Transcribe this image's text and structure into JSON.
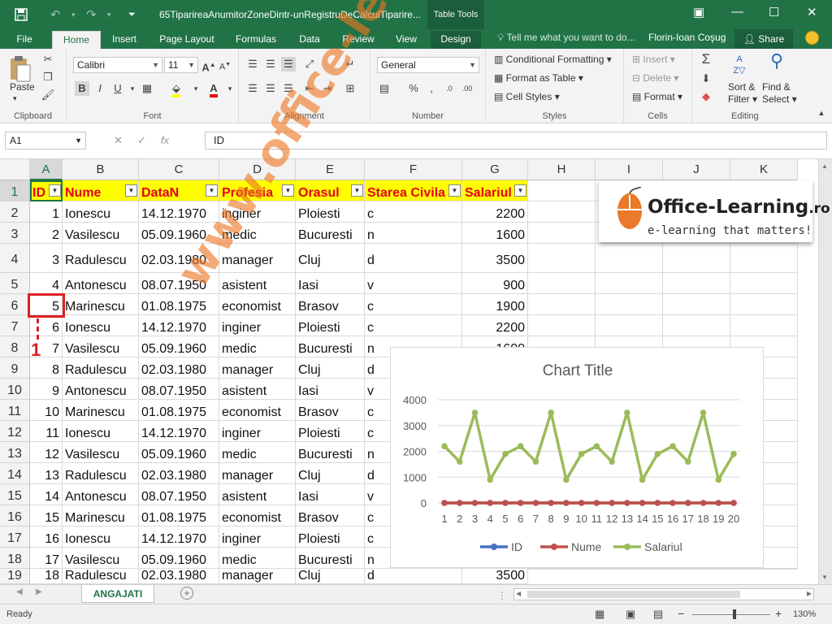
{
  "title": "65TiparireaAnumitorZoneDintr-unRegistruDeCalculTiparire...",
  "table_tools": "Table Tools",
  "tabs": [
    "File",
    "Home",
    "Insert",
    "Page Layout",
    "Formulas",
    "Data",
    "Review",
    "View",
    "Design"
  ],
  "tell_me": "Tell me what you want to do...",
  "user": "Florin-Ioan Coşug",
  "share": "Share",
  "ribbon": {
    "clipboard": {
      "label": "Clipboard",
      "paste": "Paste"
    },
    "font": {
      "label": "Font",
      "name": "Calibri",
      "size": "11"
    },
    "alignment": {
      "label": "Alignment"
    },
    "number": {
      "label": "Number",
      "format": "General"
    },
    "styles": {
      "label": "Styles",
      "conditional": "Conditional Formatting",
      "format_table": "Format as Table",
      "cell_styles": "Cell Styles"
    },
    "cells": {
      "label": "Cells",
      "insert": "Insert",
      "delete": "Delete",
      "format": "Format"
    },
    "editing": {
      "label": "Editing",
      "sort": "Sort &",
      "filter": "Filter",
      "find": "Find &",
      "select": "Select"
    }
  },
  "formula_bar": {
    "name_box": "A1",
    "value": "ID"
  },
  "columns": [
    "A",
    "B",
    "C",
    "D",
    "E",
    "F",
    "G",
    "H",
    "I",
    "J",
    "K"
  ],
  "headers": [
    "ID",
    "Nume",
    "DataN",
    "Profesia",
    "Orasul",
    "Starea Civila",
    "Salariul"
  ],
  "rows": [
    [
      "1",
      "Ionescu",
      "14.12.1970",
      "inginer",
      "Ploiesti",
      "c",
      "2200"
    ],
    [
      "2",
      "Vasilescu",
      "05.09.1960",
      "medic",
      "Bucuresti",
      "n",
      "1600"
    ],
    [
      "3",
      "Radulescu",
      "02.03.1980",
      "manager",
      "Cluj",
      "d",
      "3500"
    ],
    [
      "4",
      "Antonescu",
      "08.07.1950",
      "asistent",
      "Iasi",
      "v",
      "900"
    ],
    [
      "5",
      "Marinescu",
      "01.08.1975",
      "economist",
      "Brasov",
      "c",
      "1900"
    ],
    [
      "6",
      "Ionescu",
      "14.12.1970",
      "inginer",
      "Ploiesti",
      "c",
      "2200"
    ],
    [
      "7",
      "Vasilescu",
      "05.09.1960",
      "medic",
      "Bucuresti",
      "n",
      "1600"
    ],
    [
      "8",
      "Radulescu",
      "02.03.1980",
      "manager",
      "Cluj",
      "d",
      "3500"
    ],
    [
      "9",
      "Antonescu",
      "08.07.1950",
      "asistent",
      "Iasi",
      "v",
      "900"
    ],
    [
      "10",
      "Marinescu",
      "01.08.1975",
      "economist",
      "Brasov",
      "c",
      "1900"
    ],
    [
      "11",
      "Ionescu",
      "14.12.1970",
      "inginer",
      "Ploiesti",
      "c",
      "2200"
    ],
    [
      "12",
      "Vasilescu",
      "05.09.1960",
      "medic",
      "Bucuresti",
      "n",
      "1600"
    ],
    [
      "13",
      "Radulescu",
      "02.03.1980",
      "manager",
      "Cluj",
      "d",
      "3500"
    ],
    [
      "14",
      "Antonescu",
      "08.07.1950",
      "asistent",
      "Iasi",
      "v",
      "900"
    ],
    [
      "15",
      "Marinescu",
      "01.08.1975",
      "economist",
      "Brasov",
      "c",
      "1900"
    ],
    [
      "16",
      "Ionescu",
      "14.12.1970",
      "inginer",
      "Ploiesti",
      "c",
      "2200"
    ],
    [
      "17",
      "Vasilescu",
      "05.09.1960",
      "medic",
      "Bucuresti",
      "n",
      "1600"
    ],
    [
      "18",
      "Radulescu",
      "02.03.1980",
      "manager",
      "Cluj",
      "d",
      "3500"
    ]
  ],
  "annotation": "1",
  "sheet_tab": "ANGAJATI",
  "status": {
    "ready": "Ready",
    "zoom": "130%"
  },
  "logo": {
    "name": "Office-Learning",
    "suffix": ".ro",
    "tagline": "e-learning that matters!"
  },
  "watermark": "www.office-learning.ro",
  "chart_data": {
    "type": "line",
    "title": "Chart Title",
    "categories": [
      "1",
      "2",
      "3",
      "4",
      "5",
      "6",
      "7",
      "8",
      "9",
      "10",
      "11",
      "12",
      "13",
      "14",
      "15",
      "16",
      "17",
      "18",
      "19",
      "20"
    ],
    "ylim": [
      0,
      4000
    ],
    "yticks": [
      "0",
      "1000",
      "2000",
      "3000",
      "4000"
    ],
    "grid": true,
    "legend": "bottom",
    "series": [
      {
        "name": "ID",
        "color": "#4472c4",
        "values": [
          0,
          0,
          0,
          0,
          0,
          0,
          0,
          0,
          0,
          0,
          0,
          0,
          0,
          0,
          0,
          0,
          0,
          0,
          0,
          0
        ]
      },
      {
        "name": "Nume",
        "color": "#c0504d",
        "values": [
          0,
          0,
          0,
          0,
          0,
          0,
          0,
          0,
          0,
          0,
          0,
          0,
          0,
          0,
          0,
          0,
          0,
          0,
          0,
          0
        ]
      },
      {
        "name": "Salariul",
        "color": "#9bbb59",
        "values": [
          2200,
          1600,
          3500,
          900,
          1900,
          2200,
          1600,
          3500,
          900,
          1900,
          2200,
          1600,
          3500,
          900,
          1900,
          2200,
          1600,
          3500,
          900,
          1900
        ]
      }
    ]
  }
}
